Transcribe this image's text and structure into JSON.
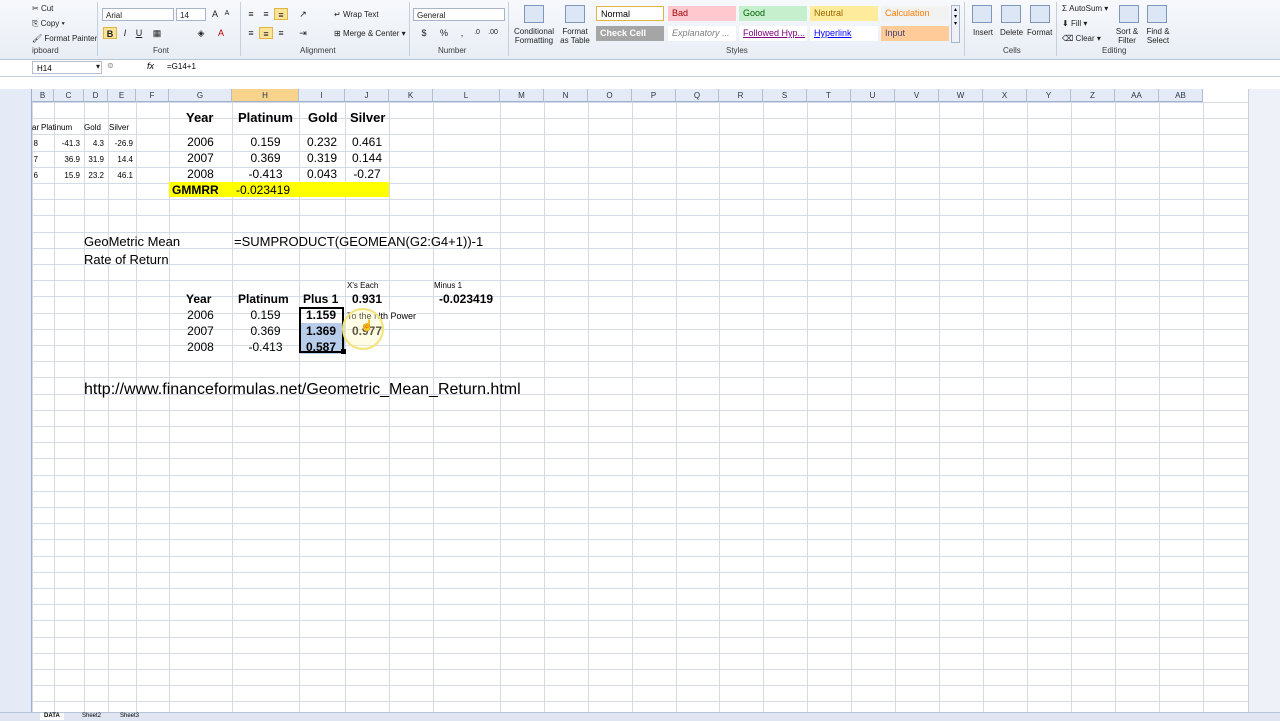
{
  "ribbon": {
    "clipboard": {
      "cut": "Cut",
      "copy": "Copy",
      "format_painter": "Format Painter",
      "label": "ipboard"
    },
    "font": {
      "name": "Arial",
      "size": "14",
      "label": "Font"
    },
    "alignment": {
      "wrap": "Wrap Text",
      "merge": "Merge & Center",
      "label": "Alignment"
    },
    "number": {
      "format": "General",
      "label": "Number",
      "currency": "$",
      "percent": "%",
      "comma": ","
    },
    "styles": {
      "conditional": "Conditional Formatting",
      "format_table": "Format as Table",
      "items": [
        {
          "label": "Normal",
          "bg": "#ffffff",
          "color": "#000000"
        },
        {
          "label": "Bad",
          "bg": "#ffc7ce",
          "color": "#9c0006"
        },
        {
          "label": "Good",
          "bg": "#c6efce",
          "color": "#006100"
        },
        {
          "label": "Neutral",
          "bg": "#ffeb9c",
          "color": "#9c6500"
        },
        {
          "label": "Calculation",
          "bg": "#f2f2f2",
          "color": "#fa7d00"
        },
        {
          "label": "Check Cell",
          "bg": "#a5a5a5",
          "color": "#ffffff"
        },
        {
          "label": "Explanatory ...",
          "bg": "#ffffff",
          "color": "#7f7f7f"
        },
        {
          "label": "Followed Hyp...",
          "bg": "#ffffff",
          "color": "#800080"
        },
        {
          "label": "Hyperlink",
          "bg": "#ffffff",
          "color": "#0000ff"
        },
        {
          "label": "Input",
          "bg": "#ffcc99",
          "color": "#3f3f76"
        }
      ],
      "label": "Styles"
    },
    "cells": {
      "insert": "Insert",
      "delete": "Delete",
      "format": "Format",
      "label": "Cells"
    },
    "editing": {
      "autosum": "AutoSum",
      "fill": "Fill",
      "clear": "Clear",
      "sort": "Sort & Filter",
      "find": "Find & Select",
      "label": "Editing"
    }
  },
  "formula_bar": {
    "name_box": "H14",
    "fx": "fx",
    "formula": "=G14+1"
  },
  "columns": [
    "B",
    "C",
    "D",
    "E",
    "F",
    "G",
    "H",
    "I",
    "J",
    "K",
    "L",
    "M",
    "N",
    "O",
    "P",
    "Q",
    "R",
    "S",
    "T",
    "U",
    "V",
    "W",
    "X",
    "Y",
    "Z",
    "AA",
    "AB"
  ],
  "selected_column": "H",
  "left_table": {
    "headers": [
      "ar",
      "Platinum",
      "Gold",
      "Silver"
    ],
    "rows": [
      [
        "8",
        "-41.3",
        "4.3",
        "-26.9"
      ],
      [
        "7",
        "36.9",
        "31.9",
        "14.4"
      ],
      [
        "6",
        "15.9",
        "23.2",
        "46.1"
      ]
    ]
  },
  "table1": {
    "headers": [
      "Year",
      "Platinum",
      "Gold",
      "Silver"
    ],
    "rows": [
      [
        "2006",
        "0.159",
        "0.232",
        "0.461"
      ],
      [
        "2007",
        "0.369",
        "0.319",
        "0.144"
      ],
      [
        "2008",
        "-0.413",
        "0.043",
        "-0.27"
      ]
    ],
    "gmmrr_label": "GMMRR",
    "gmmrr_value": "-0.023419",
    "highlight": "#ffff00"
  },
  "geomean": {
    "label1": "GeoMetric Mean",
    "label2": "Rate of Return",
    "formula": "=SUMPRODUCT(GEOMEAN(G2:G4+1))-1"
  },
  "table2": {
    "xs_each": "X's Each",
    "minus1": "Minus 1",
    "headers": [
      "Year",
      "Platinum",
      "Plus 1",
      "0.931"
    ],
    "minus1_value": "-0.023419",
    "rows": [
      [
        "2006",
        "0.159",
        "1.159"
      ],
      [
        "2007",
        "0.369",
        "1.369"
      ],
      [
        "2008",
        "-0.413",
        "0.587"
      ]
    ],
    "to_nth": "To the Nth Power",
    "i13": "0.977"
  },
  "url": "http://www.financeformulas.net/Geometric_Mean_Return.html",
  "sheet_tabs": [
    "DATA",
    "Sheet2",
    "Sheet3"
  ]
}
